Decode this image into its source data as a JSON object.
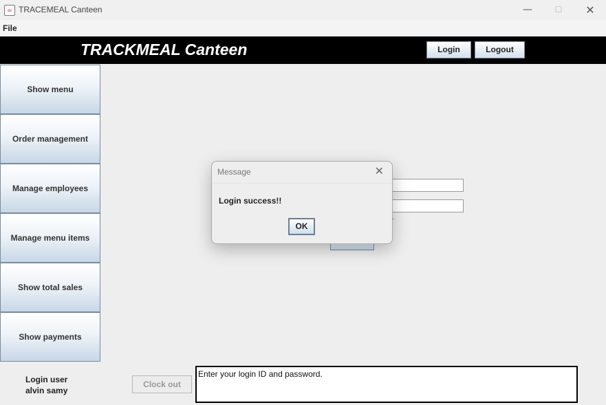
{
  "window": {
    "title": "TRACEMEAL Canteen",
    "minimize": "—",
    "maximize": "☐",
    "close": "✕"
  },
  "menu": {
    "file": "File"
  },
  "header": {
    "brand": "TRACKMEAL Canteen",
    "login_label": "Login",
    "logout_label": "Logout"
  },
  "sidebar": {
    "items": [
      {
        "label": "Show menu"
      },
      {
        "label": "Order management"
      },
      {
        "label": "Manage employees"
      },
      {
        "label": "Manage menu items"
      },
      {
        "label": "Show total sales"
      },
      {
        "label": "Show payments"
      }
    ]
  },
  "footer": {
    "login_user_label": "Login user",
    "login_user_name": "alvin samy",
    "clock_out_label": "Clock out",
    "message_text": "Enter your login ID and password."
  },
  "dialog": {
    "title": "Message",
    "message": "Login success!!",
    "ok_label": "OK",
    "close_icon": "close-icon"
  },
  "colors": {
    "header_bg": "#000000",
    "brand_text": "#ffffff",
    "button_gradient_bottom": "#c7d7e7"
  }
}
